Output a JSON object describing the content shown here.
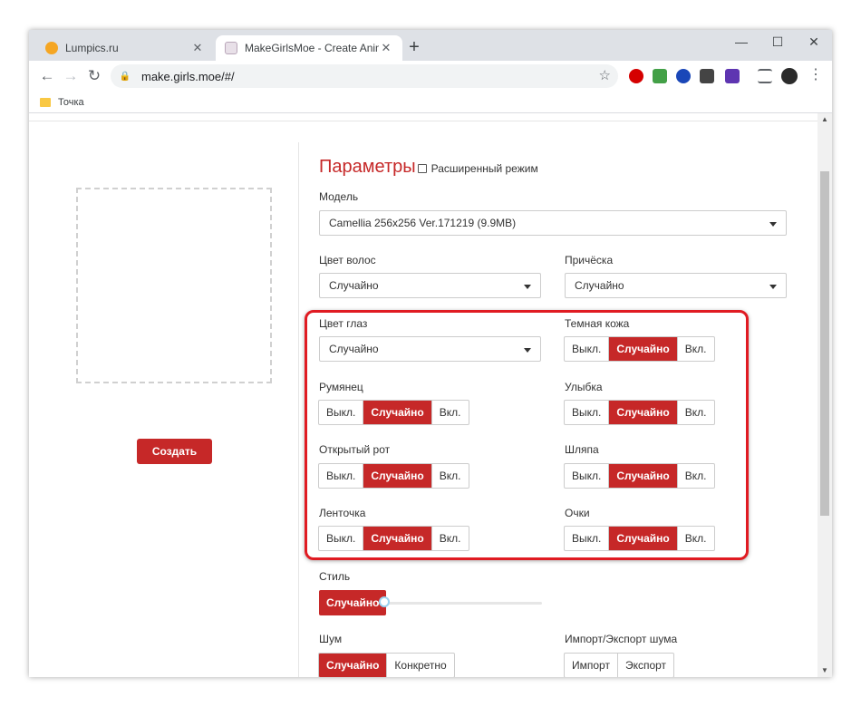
{
  "browser": {
    "tabs": [
      {
        "title": "Lumpics.ru",
        "active": false
      },
      {
        "title": "MakeGirlsMoe - Create Anime Ch",
        "active": true
      }
    ],
    "new_tab": "+",
    "window_controls": {
      "minimize": "—",
      "maximize": "☐",
      "close": "✕"
    },
    "url": "make.girls.moe/#/",
    "bookmark": "Точка"
  },
  "page": {
    "create_button": "Создать",
    "heading": "Параметры",
    "advanced_mode": "Расширенный режим",
    "model": {
      "label": "Модель",
      "value": "Camellia 256x256 Ver.171219 (9.9MB)"
    },
    "hair_color": {
      "label": "Цвет волос",
      "value": "Случайно"
    },
    "hairstyle": {
      "label": "Причёска",
      "value": "Случайно"
    },
    "eye_color": {
      "label": "Цвет глаз",
      "value": "Случайно"
    },
    "toggles": [
      {
        "label": "Темная кожа",
        "options": [
          "Выкл.",
          "Случайно",
          "Вкл."
        ],
        "selected": "Случайно"
      },
      {
        "label": "Румянец",
        "options": [
          "Выкл.",
          "Случайно",
          "Вкл."
        ],
        "selected": "Случайно"
      },
      {
        "label": "Улыбка",
        "options": [
          "Выкл.",
          "Случайно",
          "Вкл."
        ],
        "selected": "Случайно"
      },
      {
        "label": "Открытый рот",
        "options": [
          "Выкл.",
          "Случайно",
          "Вкл."
        ],
        "selected": "Случайно"
      },
      {
        "label": "Шляпа",
        "options": [
          "Выкл.",
          "Случайно",
          "Вкл."
        ],
        "selected": "Случайно"
      },
      {
        "label": "Ленточка",
        "options": [
          "Выкл.",
          "Случайно",
          "Вкл."
        ],
        "selected": "Случайно"
      },
      {
        "label": "Очки",
        "options": [
          "Выкл.",
          "Случайно",
          "Вкл."
        ],
        "selected": "Случайно"
      }
    ],
    "style": {
      "label": "Стиль",
      "button": "Случайно",
      "slider_value": 0
    },
    "noise": {
      "label": "Шум",
      "options": [
        "Случайно",
        "Конкретно"
      ],
      "selected": "Случайно"
    },
    "noise_io": {
      "label": "Импорт/Экспорт шума",
      "options": [
        "Импорт",
        "Экспорт"
      ]
    }
  },
  "colors": {
    "accent": "#c62828",
    "highlight": "#e01b22"
  }
}
